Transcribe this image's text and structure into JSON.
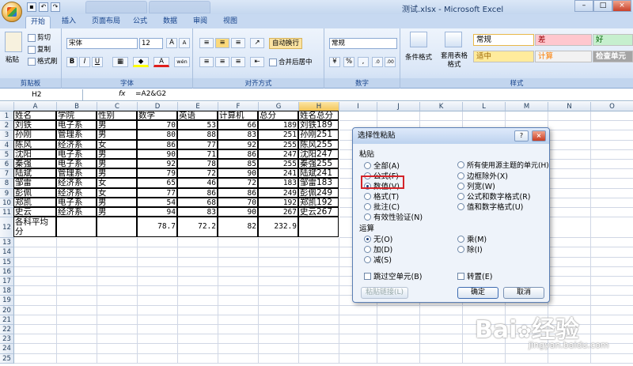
{
  "window": {
    "title": "测试.xlsx - Microsoft Excel",
    "minimize_glyph": "–",
    "maximize_glyph": "□",
    "close_glyph": "×"
  },
  "ribbon_tabs": [
    "开始",
    "插入",
    "页面布局",
    "公式",
    "数据",
    "审阅",
    "视图"
  ],
  "clipboard": {
    "paste": "粘贴",
    "cut": "剪切",
    "copy": "复制",
    "format_painter": "格式刷",
    "label": "剪贴板"
  },
  "font": {
    "name": "宋体",
    "size": "12",
    "bold": "B",
    "italic": "I",
    "underline": "U",
    "grow": "A",
    "shrink": "A",
    "color_letter": "A",
    "phonetic": "wén",
    "label": "字体"
  },
  "alignment": {
    "wrap": "自动换行",
    "merge": "合并后居中",
    "label": "对齐方式"
  },
  "number": {
    "format": "常规",
    "currency": "¥",
    "percent": "%",
    "comma": ",",
    "inc_decimal": ".0",
    "dec_decimal": ".00",
    "label": "数字"
  },
  "styles": {
    "conditional": "条件格式",
    "as_table": "套用表格格式",
    "normal": "常规",
    "bad": "差",
    "good": "好",
    "neutral": "适中",
    "calc": "计算",
    "check": "检查单元格",
    "label": "样式",
    "normal_bg": "#ffffff",
    "bad_bg": "#ffc7ce",
    "bad_fg": "#9c0006",
    "good_bg": "#c6efce",
    "good_fg": "#006100",
    "neutral_bg": "#ffeb9c",
    "neutral_fg": "#9c6500",
    "calc_bg": "#f2f2f2",
    "calc_fg": "#fa7d00",
    "check_bg": "#a5a5a5",
    "check_fg": "#ffffff"
  },
  "formula_bar": {
    "cell": "H2",
    "fx": "fx",
    "formula": "=A2&G2"
  },
  "columns": [
    "A",
    "B",
    "C",
    "D",
    "E",
    "F",
    "G",
    "H",
    "I",
    "J",
    "K",
    "L",
    "M",
    "N",
    "O"
  ],
  "rows": [
    "1",
    "2",
    "3",
    "4",
    "5",
    "6",
    "7",
    "8",
    "9",
    "10",
    "11",
    "12",
    "13",
    "14",
    "15",
    "16",
    "17",
    "18",
    "19",
    "20",
    "21",
    "22",
    "23",
    "24",
    "25"
  ],
  "sheet": {
    "header": [
      "姓名",
      "学院",
      "性别",
      "数学",
      "英语",
      "计算机",
      "总分",
      "姓名总分"
    ],
    "data": [
      [
        "刘铁",
        "电子系",
        "男",
        "70",
        "53",
        "66",
        "189",
        "刘铁189"
      ],
      [
        "孙刚",
        "管理系",
        "男",
        "80",
        "88",
        "83",
        "251",
        "孙刚251"
      ],
      [
        "陈风",
        "经济系",
        "女",
        "86",
        "77",
        "92",
        "255",
        "陈风255"
      ],
      [
        "沈阳",
        "电子系",
        "男",
        "90",
        "71",
        "86",
        "247",
        "沈阳247"
      ],
      [
        "秦强",
        "电子系",
        "男",
        "92",
        "78",
        "85",
        "255",
        "秦强255"
      ],
      [
        "陆斌",
        "管理系",
        "男",
        "79",
        "72",
        "90",
        "241",
        "陆斌241"
      ],
      [
        "邹雷",
        "经济系",
        "女",
        "65",
        "46",
        "72",
        "183",
        "邹雷183"
      ],
      [
        "彭佩",
        "经济系",
        "女",
        "77",
        "86",
        "86",
        "249",
        "彭佩249"
      ],
      [
        "郑凯",
        "电子系",
        "男",
        "54",
        "68",
        "70",
        "192",
        "郑凯192"
      ],
      [
        "史云",
        "经济系",
        "男",
        "94",
        "83",
        "90",
        "267",
        "史云267"
      ]
    ],
    "avg_label_1": "各科平均",
    "avg_label_2": "分",
    "avg": [
      "78.7",
      "72.2",
      "82",
      "232.9"
    ]
  },
  "dialog": {
    "title": "选择性粘贴",
    "help_glyph": "?",
    "close_glyph": "×",
    "paste_section": "粘贴",
    "paste_left": [
      "全部(A)",
      "公式(F)",
      "数值(V)",
      "格式(T)",
      "批注(C)",
      "有效性验证(N)"
    ],
    "paste_right": [
      "所有使用源主题的单元(H)",
      "边框除外(X)",
      "列宽(W)",
      "公式和数字格式(R)",
      "值和数字格式(U)"
    ],
    "op_section": "运算",
    "op_left": [
      "无(O)",
      "加(D)",
      "减(S)"
    ],
    "op_right": [
      "乘(M)",
      "除(I)"
    ],
    "skip_blanks": "跳过空单元(B)",
    "transpose": "转置(E)",
    "paste_link": "粘贴链接(L)",
    "ok": "确定",
    "cancel": "取消"
  },
  "watermark": {
    "brand": "Bai",
    "brand2": "经验",
    "url": "jingyan.baidu.com"
  }
}
